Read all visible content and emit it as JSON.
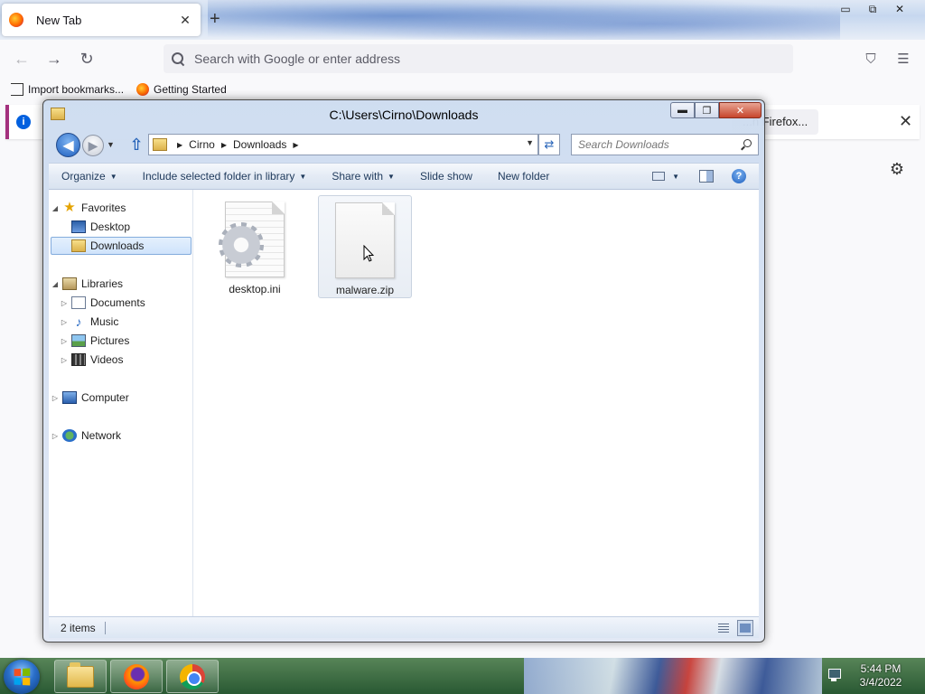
{
  "browser": {
    "tab_title": "New Tab",
    "tab_close": "✕",
    "new_tab": "+",
    "url_placeholder": "Search with Google or enter address",
    "bookmarks": [
      "Import bookmarks...",
      "Getting Started"
    ],
    "notice_button": "...h Firefox...",
    "notice_close": "✕",
    "nav_back": "←",
    "nav_forward": "→",
    "nav_reload": "↻",
    "pocket": "⛉",
    "menu": "☰",
    "gear": "⚙",
    "window_controls": [
      "▭",
      "⧉",
      "✕"
    ]
  },
  "explorer": {
    "title": "C:\\Users\\Cirno\\Downloads",
    "controls": [
      "▬",
      "❐",
      "✕"
    ],
    "back": "◀",
    "forward": "▶",
    "up": "⇧",
    "breadcrumb": [
      "Cirno",
      "Downloads"
    ],
    "refresh": "⇄",
    "search_placeholder": "Search Downloads",
    "toolbar": {
      "organize": "Organize",
      "include": "Include selected folder in library",
      "share": "Share with",
      "slideshow": "Slide show",
      "new_folder": "New folder",
      "help": "?"
    },
    "nav": {
      "favorites": "Favorites",
      "desktop": "Desktop",
      "downloads": "Downloads",
      "libraries": "Libraries",
      "documents": "Documents",
      "music": "Music",
      "pictures": "Pictures",
      "videos": "Videos",
      "computer": "Computer",
      "network": "Network"
    },
    "files": [
      {
        "name": "desktop.ini",
        "icon": "settings-file-icon"
      },
      {
        "name": "malware.zip",
        "icon": "blank-file-icon"
      }
    ],
    "status_count": "2 items"
  },
  "taskbar": {
    "time": "5:44 PM",
    "date": "3/4/2022"
  }
}
